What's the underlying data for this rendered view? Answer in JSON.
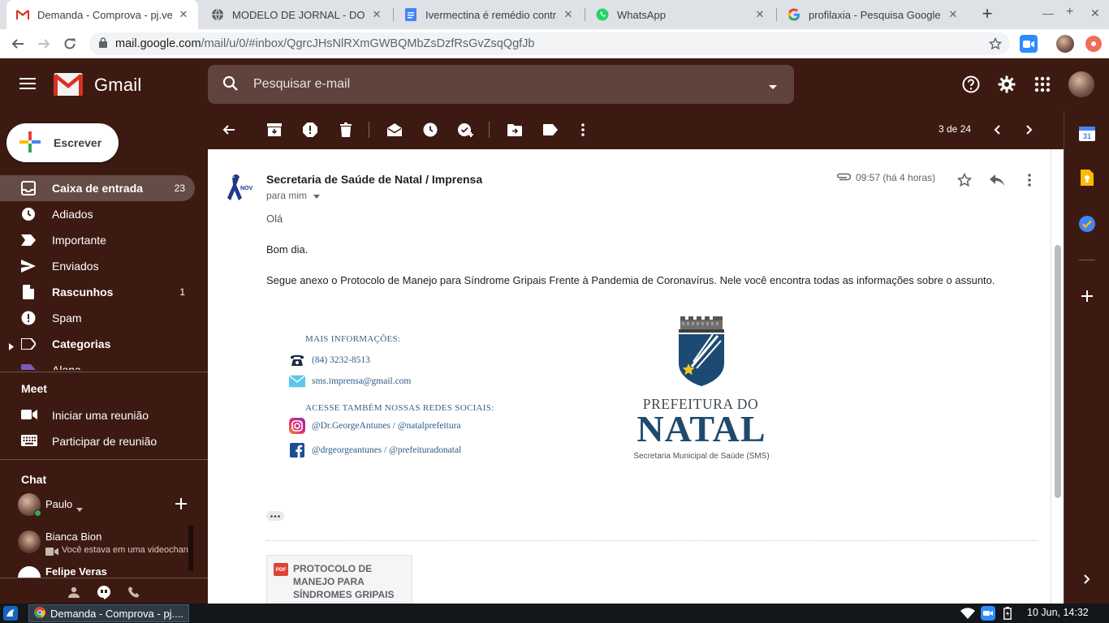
{
  "browser": {
    "tabs": [
      {
        "title": "Demanda - Comprova - pj.ve",
        "icon": "gmail-favicon",
        "active": true
      },
      {
        "title": "MODELO DE JORNAL - DOM",
        "icon": "globe-favicon",
        "active": false
      },
      {
        "title": "Ivermectina é remédio contra",
        "icon": "docs-favicon",
        "active": false
      },
      {
        "title": "WhatsApp",
        "icon": "whatsapp-favicon",
        "active": false
      },
      {
        "title": "profilaxia - Pesquisa Google",
        "icon": "google-favicon",
        "active": false
      }
    ],
    "url_host": "mail.google.com",
    "url_path": "/mail/u/0/#inbox/QgrcJHsNlRXmGWBQMbZsDzfRsGvZsqQgfJb"
  },
  "gmail": {
    "brand": "Gmail",
    "search_placeholder": "Pesquisar e-mail",
    "compose_label": "Escrever",
    "theme_color": "#3c1a12",
    "nav": [
      {
        "label": "Caixa de entrada",
        "count": "23",
        "icon": "inbox-icon",
        "bold": true,
        "active": true
      },
      {
        "label": "Adiados",
        "count": "",
        "icon": "clock-icon",
        "bold": false,
        "active": false
      },
      {
        "label": "Importante",
        "count": "",
        "icon": "important-icon",
        "bold": false,
        "active": false
      },
      {
        "label": "Enviados",
        "count": "",
        "icon": "send-icon",
        "bold": false,
        "active": false
      },
      {
        "label": "Rascunhos",
        "count": "1",
        "icon": "draft-icon",
        "bold": true,
        "active": false
      },
      {
        "label": "Spam",
        "count": "",
        "icon": "spam-icon",
        "bold": false,
        "active": false
      },
      {
        "label": "Categorias",
        "count": "",
        "icon": "label-icon",
        "bold": true,
        "active": false
      },
      {
        "label": "Alana",
        "count": "",
        "icon": "label-icon",
        "bold": false,
        "active": false
      }
    ],
    "meet": {
      "heading": "Meet",
      "items": [
        {
          "label": "Iniciar uma reunião",
          "icon": "video-icon"
        },
        {
          "label": "Participar de reunião",
          "icon": "keyboard-icon"
        }
      ]
    },
    "chat": {
      "heading": "Chat",
      "me": "Paulo",
      "contacts": [
        {
          "name": "Bianca Bion",
          "status": "Você estava em uma videochan"
        },
        {
          "name": "Felipe Veras",
          "status": ""
        }
      ]
    },
    "pager": "3 de 24"
  },
  "message": {
    "sender": "Secretaria de Saúde de Natal / Imprensa",
    "to": "para mim",
    "time": "09:57 (há 4 horas)",
    "lines": [
      "Olá",
      "Bom dia.",
      "Segue anexo o Protocolo de Manejo para Síndrome Gripais Frente à Pandemia de Coronavírus. Nele você encontra todas as informações sobre o assunto."
    ],
    "info": {
      "more_info": "MAIS INFORMAÇÕES:",
      "phone": "(84) 3232-8513",
      "email": "sms.imprensa@gmail.com",
      "social_heading": "ACESSE TAMBÉM NOSSAS REDES SOCIAIS:",
      "instagram": "@Dr.GeorgeAntunes / @natalprefeitura",
      "facebook": "@drgeorgeantunes / @prefeituradonatal"
    },
    "prefeitura": {
      "line1": "PREFEITURA DO",
      "line2": "NATAL",
      "sub": "Secretaria Municipal de Saúde (SMS)"
    },
    "attachment": {
      "badge": "PDF",
      "name": "PROTOCOLO DE MANEJO PARA SÍNDROMES GRIPAIS"
    }
  },
  "taskbar": {
    "task": "Demanda - Comprova - pj....",
    "clock": "10 Jun, 14:32"
  }
}
